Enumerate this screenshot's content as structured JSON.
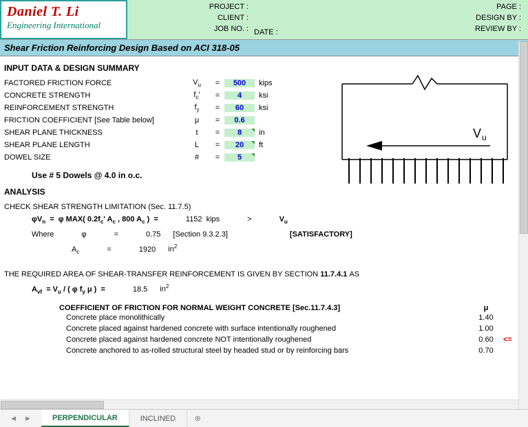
{
  "logo": {
    "name": "Daniel T. Li",
    "sub": "Engineering International"
  },
  "meta": {
    "project": "PROJECT :",
    "client": "CLIENT :",
    "jobno": "JOB NO. :",
    "date": "DATE :",
    "page": "PAGE :",
    "design": "DESIGN BY :",
    "review": "REVIEW BY :"
  },
  "title": "Shear Friction Reinforcing Design Based on ACI 318-05",
  "headings": {
    "input": "INPUT DATA & DESIGN SUMMARY",
    "analysis": "ANALYSIS",
    "check": "CHECK SHEAR STRENGTH LIMITATION (Sec. 11.7.5)",
    "req": "THE REQUIRED AREA OF SHEAR-TRANSFER REINFORCEMENT IS GIVEN BY SECTION",
    "req_sec": "11.7.4.1",
    "req_as": "AS",
    "coef": "COEFFICIENT OF FRICTION FOR NORMAL WEIGHT CONCRETE [Sec.11.7.4.3]"
  },
  "inputs": [
    {
      "label": "FACTORED FRICTION FORCE",
      "symHtml": "V<sub>u</sub>",
      "val": "500",
      "unit": "kips",
      "kind": "input"
    },
    {
      "label": "CONCRETE STRENGTH",
      "symHtml": "f<sub>c</sub>'",
      "val": "4",
      "unit": "ksi",
      "kind": "input"
    },
    {
      "label": "REINFORCEMENT STRENGTH",
      "symHtml": "f<sub>y</sub>",
      "val": "60",
      "unit": "ksi",
      "kind": "input"
    },
    {
      "label": "FRICTION COEFFICIENT [See Table below]",
      "symHtml": "μ",
      "val": "0.6",
      "unit": "",
      "kind": "input"
    },
    {
      "label": "SHEAR PLANE THICKNESS",
      "symHtml": "t",
      "val": "8",
      "unit": "in",
      "kind": "inputd"
    },
    {
      "label": "SHEAR PLANE LENGTH",
      "symHtml": "L",
      "val": "20",
      "unit": "ft",
      "kind": "inputd"
    },
    {
      "label": "DOWEL SIZE",
      "symHtml": "#",
      "val": "5",
      "unit": "",
      "kind": "inputd"
    }
  ],
  "use_row": "Use     #     5     Dowels     @        4.0     in o.c.",
  "analysis": {
    "phi_formula_pre": "φV",
    "phi_formula": "  =  φ MAX( 0.2f",
    "phi_formula_mid": "' A",
    "phi_formula_post": " , 800 A",
    "phi_formula_end": " )  =",
    "phi_vn_val": "1152",
    "phi_vn_unit": "kips",
    "gt": ">",
    "vu": "V",
    "where": "Where",
    "phi_sym": "φ",
    "phi_val": "0.75",
    "phi_note": "[Section 9.3.2.3]",
    "sat": "[SATISFACTORY]",
    "ac_sym": "A",
    "ac_val": "1920",
    "ac_unit": "in",
    "avf_formula_pre": "A",
    "avf_formula": "  = V",
    "avf_formula2": " / ( φ f",
    "avf_formula3": " μ )  =",
    "avf_val": "18.5",
    "avf_unit": "in"
  },
  "coef": {
    "mu": "μ",
    "rows": [
      {
        "desc": "Concrete place monolithically",
        "val": "1.40",
        "mark": ""
      },
      {
        "desc": "Concrete placed against hardened concrete with surface intentionally roughened",
        "val": "1.00",
        "mark": ""
      },
      {
        "desc": "Concrete placed against hardened concrete NOT intentionally roughened",
        "val": "0.60",
        "mark": "<="
      },
      {
        "desc": "Concrete anchored to as-rolled structural steel by headed stud or by reinforcing bars",
        "val": "0.70",
        "mark": ""
      }
    ]
  },
  "diagram": {
    "vu": "V",
    "vu_sub": "u"
  },
  "tabs": {
    "perp": "PERPENDICULAR",
    "incl": "INCLINED"
  }
}
